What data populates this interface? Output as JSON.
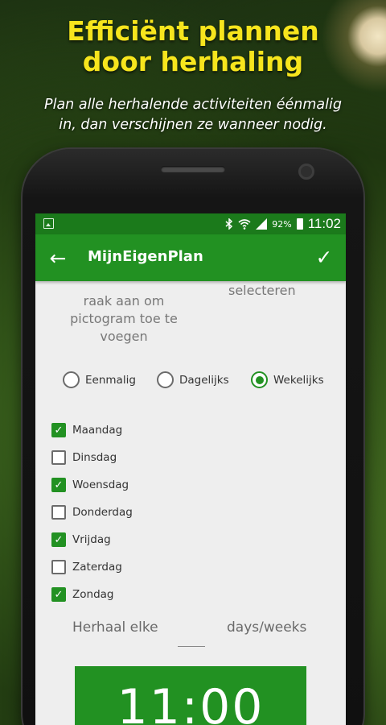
{
  "promo": {
    "headline_line1": "Efficiënt plannen",
    "headline_line2": "door herhaling",
    "sub_line1": "Plan alle herhalende activiteiten éénmalig",
    "sub_line2": "in, dan verschijnen ze wanneer nodig."
  },
  "status_bar": {
    "battery": "92%",
    "time": "11:02",
    "icons": [
      "image-icon",
      "bluetooth-icon",
      "wifi-icon",
      "signal-icon",
      "battery-icon"
    ]
  },
  "app_bar": {
    "title": "MijnEigenPlan",
    "back_icon": "arrow-back-icon",
    "confirm_icon": "check-icon",
    "back_glyph": "←",
    "confirm_glyph": "✓"
  },
  "content": {
    "icon_hint": "raak aan om pictogram toe te voegen",
    "select_hint": "selecteren",
    "frequency": {
      "options": [
        "Eenmalig",
        "Dagelijks",
        "Wekelijks"
      ],
      "selected": "Wekelijks"
    },
    "days": [
      {
        "label": "Maandag",
        "checked": true
      },
      {
        "label": "Dinsdag",
        "checked": false
      },
      {
        "label": "Woensdag",
        "checked": true
      },
      {
        "label": "Donderdag",
        "checked": false
      },
      {
        "label": "Vrijdag",
        "checked": true
      },
      {
        "label": "Zaterdag",
        "checked": false
      },
      {
        "label": "Zondag",
        "checked": true
      }
    ],
    "repeat": {
      "label_before": "Herhaal elke",
      "value": "",
      "label_after": "days/weeks"
    },
    "time": "11:00"
  },
  "colors": {
    "headline": "#f7e51d",
    "status_bar": "#1b7a1b",
    "app_bar": "#229122",
    "accent": "#229122",
    "screen_bg": "#eeeeee"
  }
}
